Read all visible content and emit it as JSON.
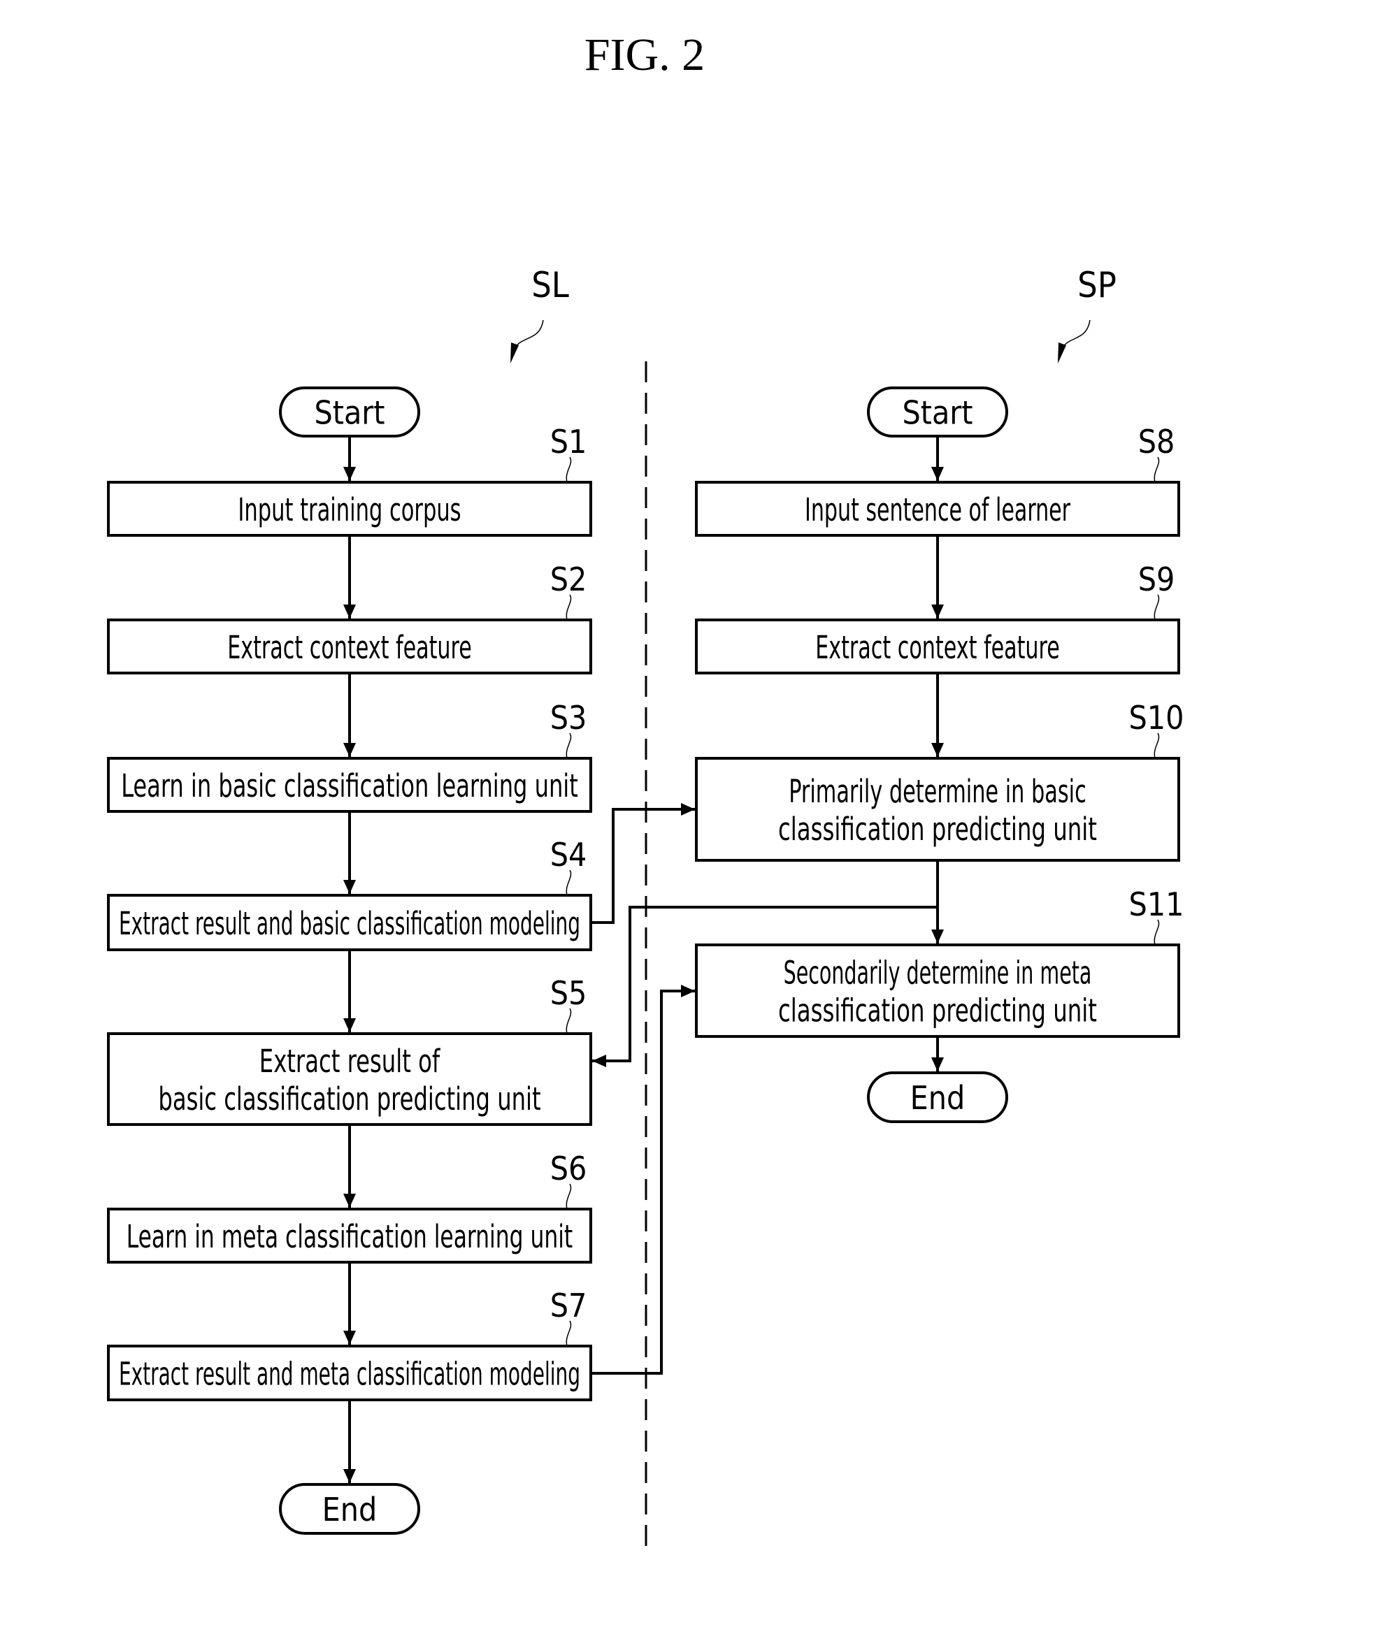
{
  "title": "FIG. 2",
  "flows": {
    "learning": {
      "label": "SL",
      "start": "Start",
      "end": "End",
      "steps": [
        {
          "id": "S1",
          "lines": [
            "Input training corpus"
          ]
        },
        {
          "id": "S2",
          "lines": [
            "Extract context feature"
          ]
        },
        {
          "id": "S3",
          "lines": [
            "Learn in basic classification learning unit"
          ]
        },
        {
          "id": "S4",
          "lines": [
            "Extract result and basic classification modeling"
          ]
        },
        {
          "id": "S5",
          "lines": [
            "Extract result of",
            "basic classification predicting unit"
          ]
        },
        {
          "id": "S6",
          "lines": [
            "Learn in meta classification learning unit"
          ]
        },
        {
          "id": "S7",
          "lines": [
            "Extract result and meta classification modeling"
          ]
        }
      ]
    },
    "predicting": {
      "label": "SP",
      "start": "Start",
      "end": "End",
      "steps": [
        {
          "id": "S8",
          "lines": [
            "Input sentence of learner"
          ]
        },
        {
          "id": "S9",
          "lines": [
            "Extract context feature"
          ]
        },
        {
          "id": "S10",
          "lines": [
            "Primarily determine in basic",
            "classification predicting unit"
          ]
        },
        {
          "id": "S11",
          "lines": [
            "Secondarily determine in meta",
            "classification predicting unit"
          ]
        }
      ]
    }
  },
  "connections": [
    {
      "from": "S4",
      "to": "S10"
    },
    {
      "from": "S10",
      "to": "S5"
    },
    {
      "from": "S7",
      "to": "S11"
    }
  ]
}
